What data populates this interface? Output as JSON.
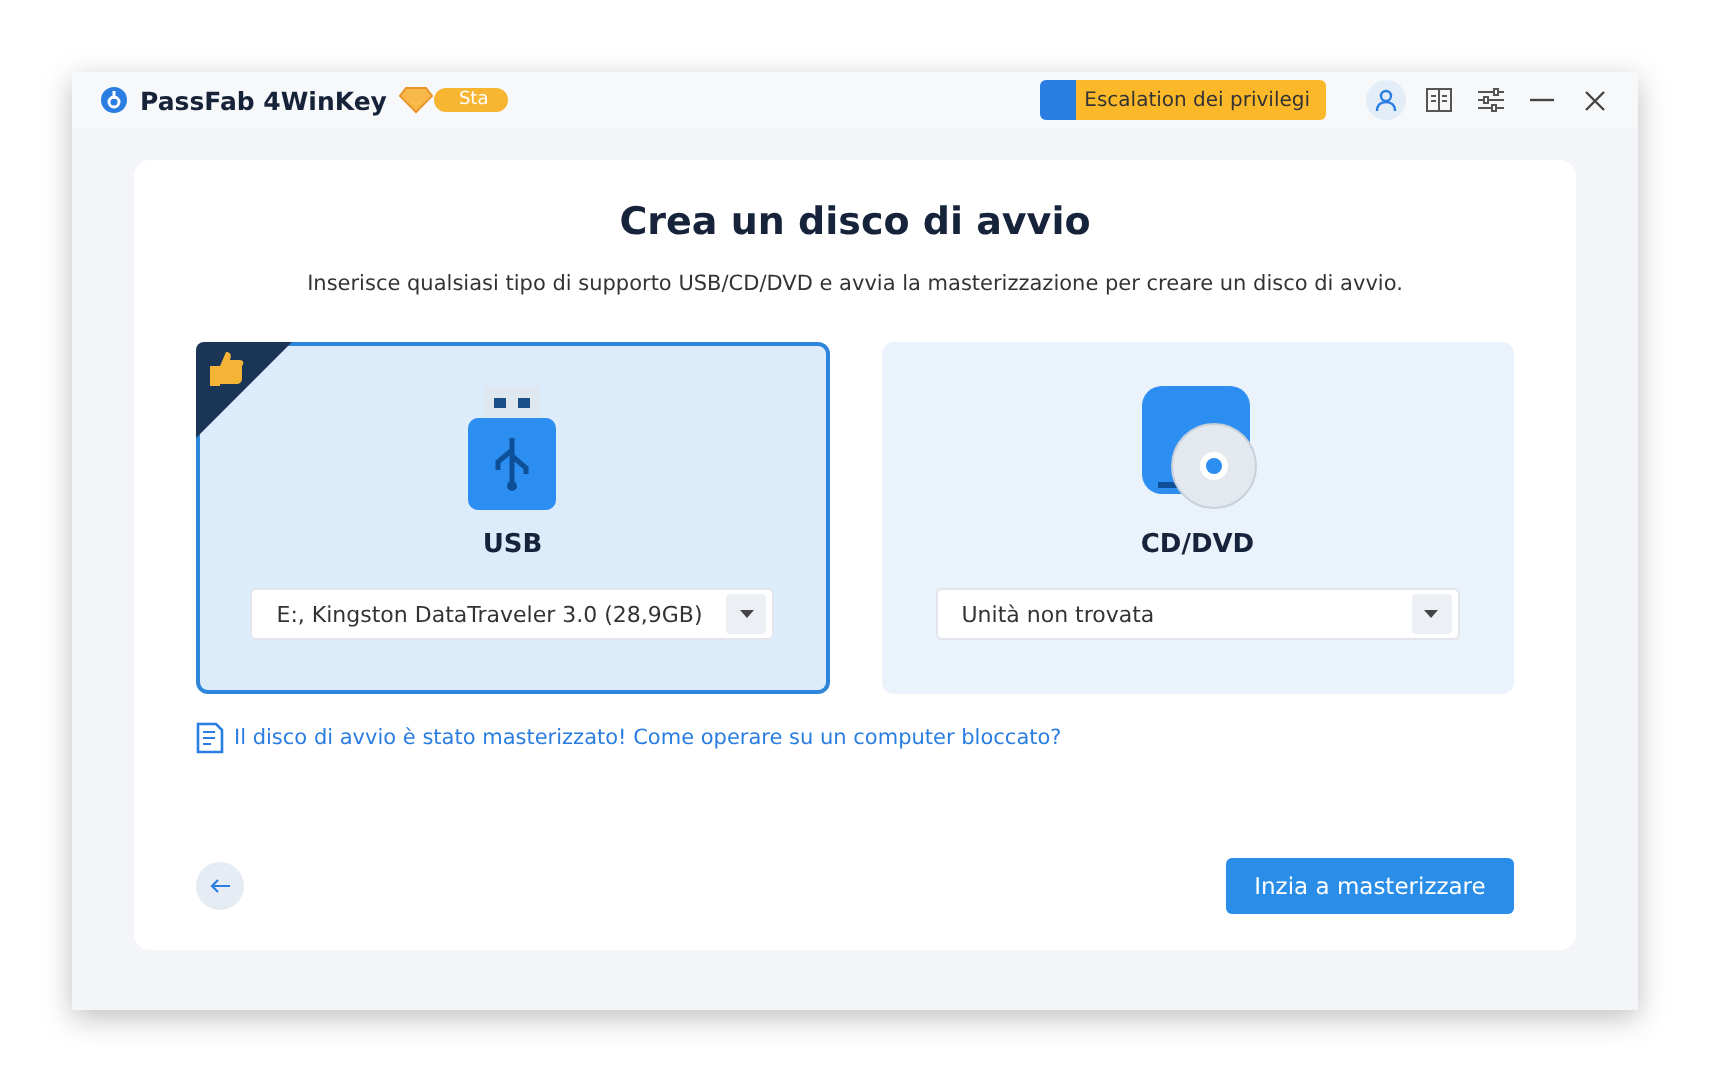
{
  "window": {
    "title": "PassFab 4WinKey",
    "badge": "Sta",
    "privilege_button": "Escalation dei privilegi"
  },
  "page": {
    "title": "Crea un disco di avvio",
    "subtitle": "Inserisce qualsiasi tipo di supporto USB/CD/DVD e avvia la masterizzazione per creare un disco di avvio."
  },
  "media": [
    {
      "kind": "usb",
      "label": "USB",
      "selected": true,
      "dropdown": "E:, Kingston DataTraveler 3.0 (28,9GB)"
    },
    {
      "kind": "cd",
      "label": "CD/DVD",
      "selected": false,
      "dropdown": "Unità non trovata"
    }
  ],
  "help_link": "Il disco di avvio è stato masterizzato! Come operare su un computer bloccato?",
  "start_button": "Inzia a masterizzare"
}
